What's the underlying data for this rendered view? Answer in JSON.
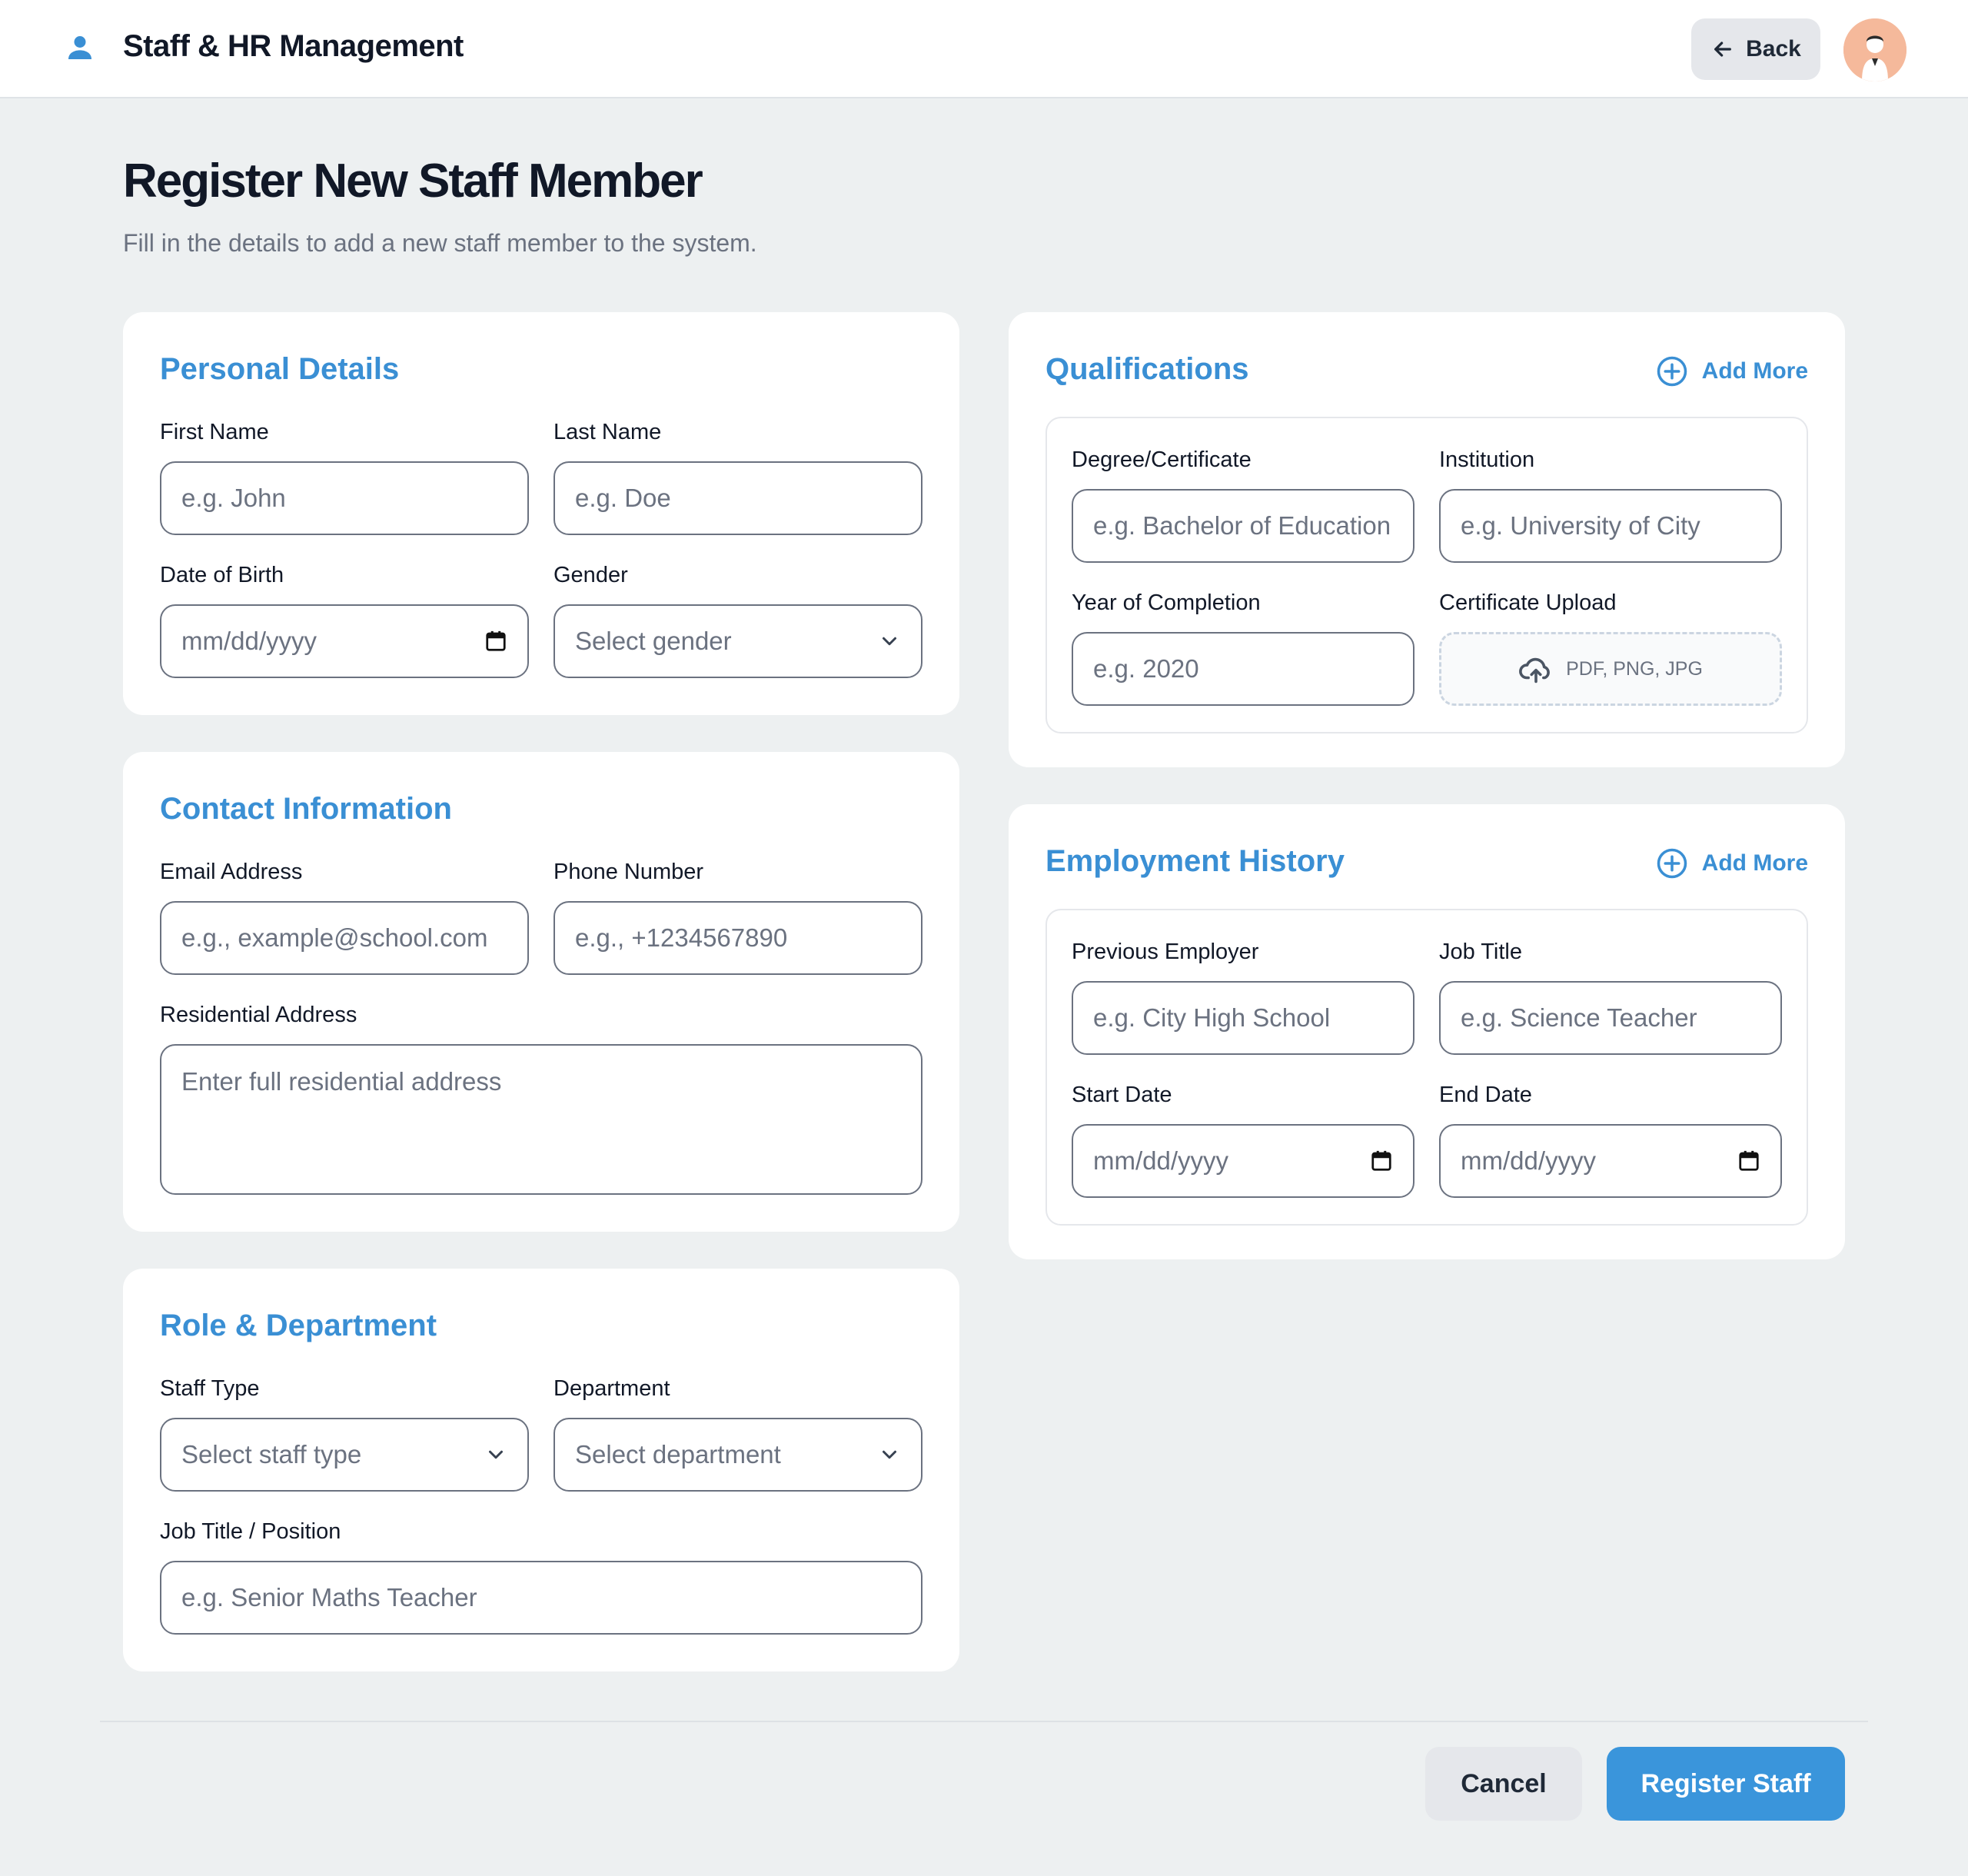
{
  "header": {
    "title": "Staff & HR Management",
    "back_label": "Back"
  },
  "page": {
    "title": "Register New Staff Member",
    "subtitle": "Fill in the details to add a new staff member to the system."
  },
  "personal": {
    "title": "Personal Details",
    "first_name_label": "First Name",
    "first_name_placeholder": "e.g. John",
    "last_name_label": "Last Name",
    "last_name_placeholder": "e.g. Doe",
    "dob_label": "Date of Birth",
    "dob_placeholder": "mm/dd/yyyy",
    "gender_label": "Gender",
    "gender_selected": "Select gender"
  },
  "contact": {
    "title": "Contact Information",
    "email_label": "Email Address",
    "email_placeholder": "e.g., example@school.com",
    "phone_label": "Phone Number",
    "phone_placeholder": "e.g., +1234567890",
    "address_label": "Residential Address",
    "address_placeholder": "Enter full residential address"
  },
  "role": {
    "title": "Role & Department",
    "staff_type_label": "Staff Type",
    "staff_type_selected": "Select staff type",
    "department_label": "Department",
    "department_selected": "Select department",
    "job_title_label": "Job Title / Position",
    "job_title_placeholder": "e.g. Senior Maths Teacher"
  },
  "qualifications": {
    "title": "Qualifications",
    "add_more_label": "Add More",
    "degree_label": "Degree/Certificate",
    "degree_placeholder": "e.g. Bachelor of Education",
    "institution_label": "Institution",
    "institution_placeholder": "e.g. University of City",
    "year_label": "Year of Completion",
    "year_placeholder": "e.g. 2020",
    "upload_label": "Certificate Upload",
    "upload_hint": "PDF, PNG, JPG"
  },
  "employment": {
    "title": "Employment History",
    "add_more_label": "Add More",
    "employer_label": "Previous Employer",
    "employer_placeholder": "e.g. City High School",
    "job_title_label": "Job Title",
    "job_title_placeholder": "e.g. Science Teacher",
    "start_label": "Start Date",
    "start_placeholder": "mm/dd/yyyy",
    "end_label": "End Date",
    "end_placeholder": "mm/dd/yyyy"
  },
  "footer": {
    "cancel_label": "Cancel",
    "register_label": "Register Staff"
  },
  "colors": {
    "accent": "#3a95db",
    "section_title": "#3a8fd4",
    "background": "#edf0f1",
    "avatar_bg": "#f5b99b"
  },
  "icons": [
    "person-icon",
    "arrow-left-icon",
    "avatar",
    "calendar-icon",
    "chevron-down-icon",
    "plus-circle-icon",
    "cloud-upload-icon"
  ]
}
